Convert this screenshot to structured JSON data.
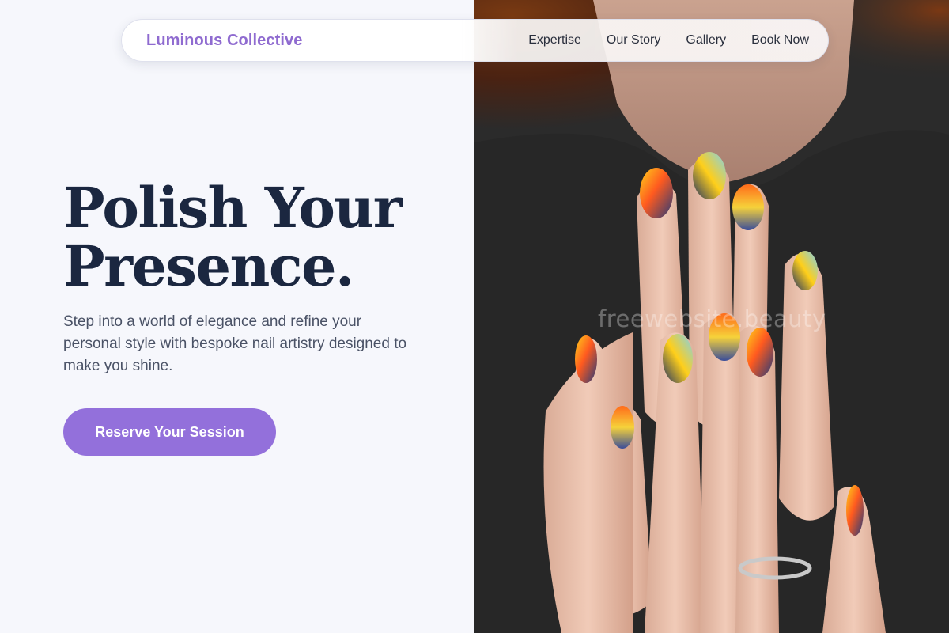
{
  "nav": {
    "brand": "Luminous Collective",
    "links": [
      {
        "label": "Expertise"
      },
      {
        "label": "Our Story"
      },
      {
        "label": "Gallery"
      },
      {
        "label": "Book Now"
      }
    ]
  },
  "hero": {
    "headline_line1": "Polish Your",
    "headline_line2": "Presence.",
    "subtext": "Step into a world of elegance and refine your personal style with bespoke nail artistry designed to make you shine.",
    "cta_label": "Reserve Your Session",
    "image_alt": "Hands with colorful abstract painted nails"
  },
  "watermark": "freewebsite.beauty",
  "colors": {
    "accent": "#9370db",
    "brand_text": "#8f6bd0",
    "headline": "#1b2740",
    "background": "#f6f7fc"
  }
}
